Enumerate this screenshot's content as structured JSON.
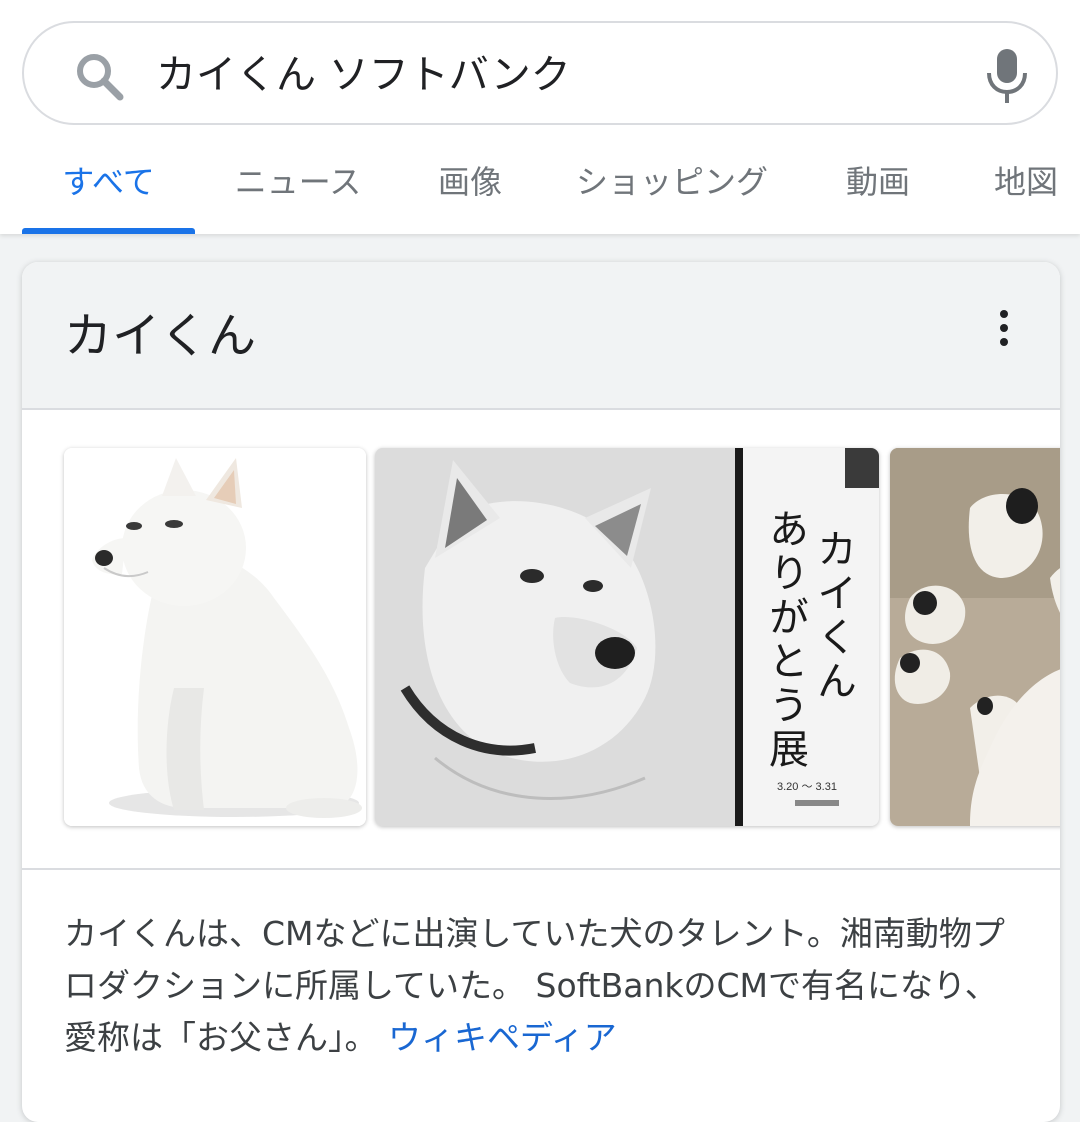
{
  "search": {
    "query": "カイくん ソフトバンク"
  },
  "tabs": [
    {
      "label": "すべて",
      "active": true
    },
    {
      "label": "ニュース"
    },
    {
      "label": "画像"
    },
    {
      "label": "ショッピング"
    },
    {
      "label": "動画"
    },
    {
      "label": "地図"
    }
  ],
  "knowledge_panel": {
    "title": "カイくん",
    "images": [
      {
        "subject": "white dog sitting"
      },
      {
        "subject": "dog portrait with sign",
        "sign_text": "カイくん ありがとう展",
        "sign_small": "3.20～3.31"
      },
      {
        "subject": "dog figurines"
      }
    ],
    "description": "カイくんは、CMなどに出演していた犬のタレント。湘南動物プロダクションに所属していた。 SoftBankのCMで有名になり、愛称は「お父さん」。",
    "source_link": "ウィキペディア"
  },
  "colors": {
    "accent": "#1a73e8",
    "link": "#1967d2",
    "text": "#202124",
    "muted": "#70757a"
  }
}
